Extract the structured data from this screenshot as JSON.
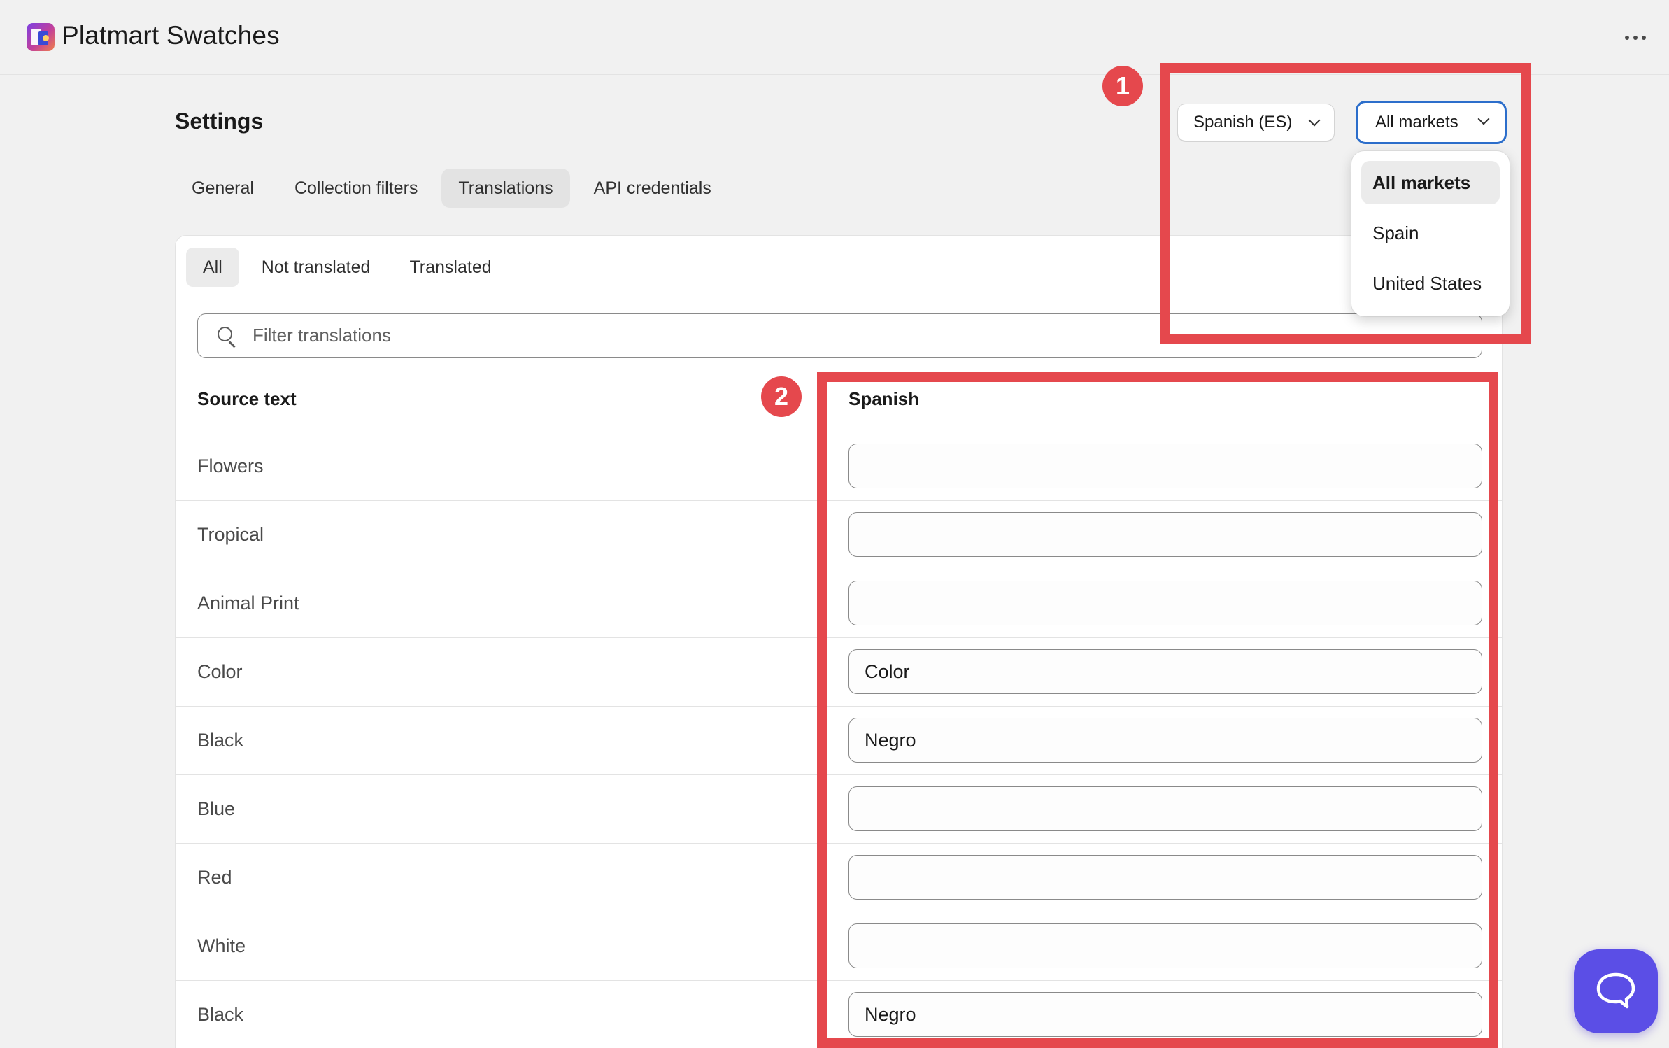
{
  "app": {
    "title": "Platmart Swatches"
  },
  "page": {
    "title": "Settings",
    "tabs": [
      {
        "label": "General"
      },
      {
        "label": "Collection filters"
      },
      {
        "label": "Translations"
      },
      {
        "label": "API credentials"
      }
    ],
    "active_tab": "Translations"
  },
  "filters": {
    "subtabs": [
      {
        "label": "All"
      },
      {
        "label": "Not translated"
      },
      {
        "label": "Translated"
      }
    ],
    "active_subtab": "All",
    "search_placeholder": "Filter translations",
    "search_value": ""
  },
  "table": {
    "source_header": "Source text",
    "target_header": "Spanish",
    "rows": [
      {
        "source": "Flowers",
        "translation": ""
      },
      {
        "source": "Tropical",
        "translation": ""
      },
      {
        "source": "Animal Print",
        "translation": ""
      },
      {
        "source": "Color",
        "translation": "Color"
      },
      {
        "source": "Black",
        "translation": "Negro"
      },
      {
        "source": "Blue",
        "translation": ""
      },
      {
        "source": "Red",
        "translation": ""
      },
      {
        "source": "White",
        "translation": ""
      },
      {
        "source": "Black",
        "translation": "Negro"
      }
    ]
  },
  "selectors": {
    "language": "Spanish (ES)",
    "market": "All markets",
    "market_options": [
      {
        "label": "All markets",
        "selected": true
      },
      {
        "label": "Spain",
        "selected": false
      },
      {
        "label": "United States",
        "selected": false
      }
    ]
  },
  "annotations": [
    {
      "number": "1"
    },
    {
      "number": "2"
    }
  ],
  "colors": {
    "annotation": "#e5484d",
    "focus_ring": "#2c6ecb",
    "chat_button": "#5b4ee6"
  },
  "icons": {
    "more": "more-horizontal-icon",
    "search": "search-icon",
    "chevron": "chevron-down-icon",
    "chat": "chat-bubble-icon"
  }
}
